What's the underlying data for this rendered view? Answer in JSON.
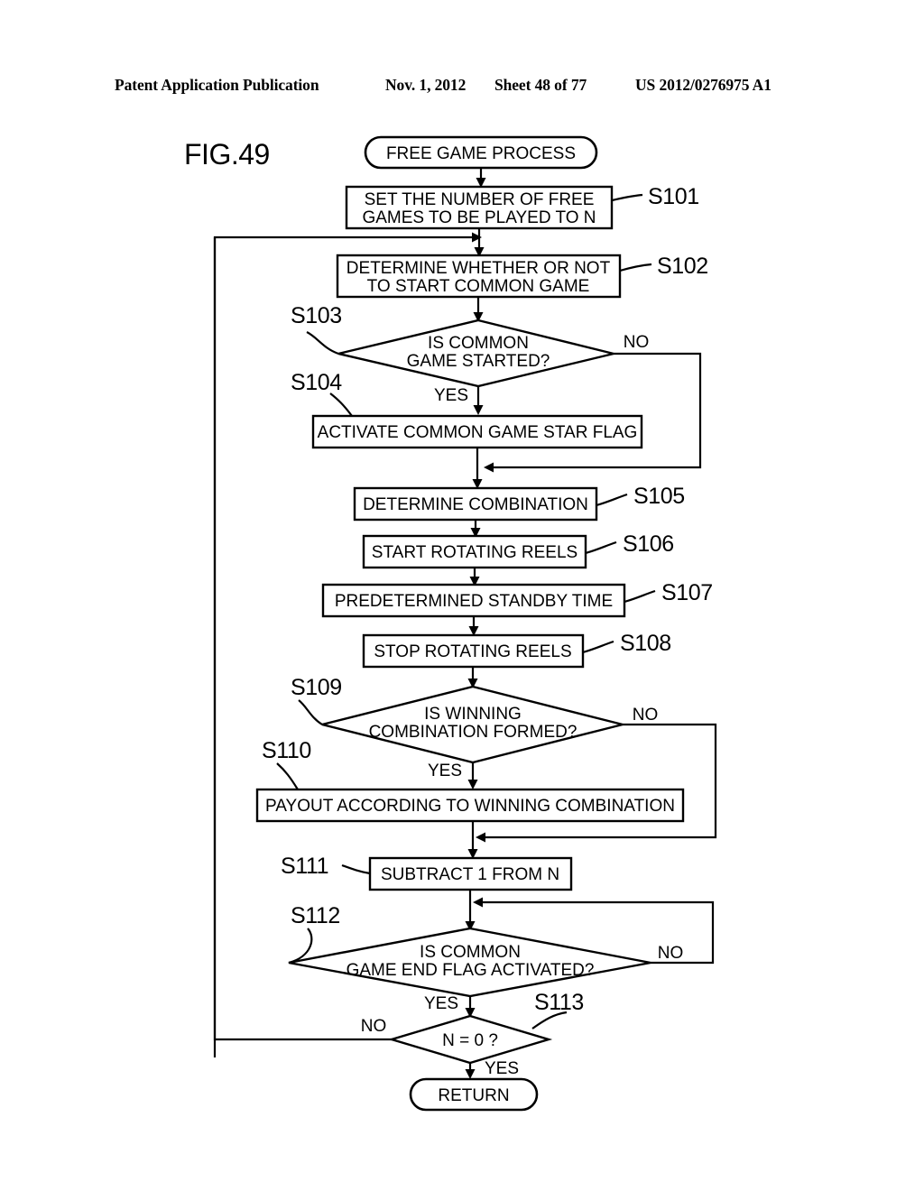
{
  "header": {
    "publication": "Patent Application Publication",
    "date": "Nov. 1, 2012",
    "sheet": "Sheet 48 of 77",
    "number": "US 2012/0276975 A1"
  },
  "figure": {
    "label": "FIG.49"
  },
  "chart_data": {
    "type": "diagram",
    "diagram_kind": "flowchart",
    "title": "FIG.49",
    "nodes": [
      {
        "id": "start",
        "shape": "terminator",
        "text": "FREE GAME PROCESS",
        "step": ""
      },
      {
        "id": "s101",
        "shape": "process",
        "text": "SET THE NUMBER OF FREE GAMES TO BE PLAYED TO N",
        "line1": "SET THE NUMBER OF FREE",
        "line2": "GAMES TO BE PLAYED TO N",
        "step": "S101"
      },
      {
        "id": "s102",
        "shape": "process",
        "text": "DETERMINE WHETHER OR NOT TO START COMMON GAME",
        "line1": "DETERMINE WHETHER OR NOT",
        "line2": "TO START COMMON GAME",
        "step": "S102"
      },
      {
        "id": "s103",
        "shape": "decision",
        "text": "IS COMMON GAME STARTED?",
        "line1": "IS COMMON",
        "line2": "GAME STARTED?",
        "step": "S103"
      },
      {
        "id": "s104",
        "shape": "process",
        "text": "ACTIVATE COMMON GAME STAR FLAG",
        "line1": "ACTIVATE COMMON GAME STAR FLAG",
        "step": "S104"
      },
      {
        "id": "s105",
        "shape": "process",
        "text": "DETERMINE COMBINATION",
        "line1": "DETERMINE COMBINATION",
        "step": "S105"
      },
      {
        "id": "s106",
        "shape": "process",
        "text": "START ROTATING REELS",
        "line1": "START ROTATING REELS",
        "step": "S106"
      },
      {
        "id": "s107",
        "shape": "process",
        "text": "PREDETERMINED STANDBY TIME",
        "line1": "PREDETERMINED STANDBY TIME",
        "step": "S107"
      },
      {
        "id": "s108",
        "shape": "process",
        "text": "STOP ROTATING REELS",
        "line1": "STOP ROTATING REELS",
        "step": "S108"
      },
      {
        "id": "s109",
        "shape": "decision",
        "text": "IS WINNING COMBINATION FORMED?",
        "line1": "IS WINNING",
        "line2": "COMBINATION FORMED?",
        "step": "S109"
      },
      {
        "id": "s110",
        "shape": "process",
        "text": "PAYOUT ACCORDING TO WINNING COMBINATION",
        "line1": "PAYOUT ACCORDING TO WINNING COMBINATION",
        "step": "S110"
      },
      {
        "id": "s111",
        "shape": "process",
        "text": "SUBTRACT 1 FROM N",
        "line1": "SUBTRACT 1 FROM N",
        "step": "S111"
      },
      {
        "id": "s112",
        "shape": "decision",
        "text": "IS COMMON GAME END FLAG ACTIVATED?",
        "line1": "IS COMMON",
        "line2": "GAME END FLAG ACTIVATED?",
        "step": "S112"
      },
      {
        "id": "s113",
        "shape": "decision",
        "text": "N = 0 ?",
        "line1": "N = 0 ?",
        "step": "S113"
      },
      {
        "id": "return",
        "shape": "terminator",
        "text": "RETURN",
        "step": ""
      }
    ],
    "edges": [
      {
        "from": "start",
        "to": "s101",
        "label": ""
      },
      {
        "from": "s101",
        "to": "s102",
        "label": ""
      },
      {
        "from": "s102",
        "to": "s103",
        "label": ""
      },
      {
        "from": "s103",
        "to": "s104",
        "label": "YES"
      },
      {
        "from": "s103",
        "to": "s105",
        "label": "NO"
      },
      {
        "from": "s104",
        "to": "s105",
        "label": ""
      },
      {
        "from": "s105",
        "to": "s106",
        "label": ""
      },
      {
        "from": "s106",
        "to": "s107",
        "label": ""
      },
      {
        "from": "s107",
        "to": "s108",
        "label": ""
      },
      {
        "from": "s108",
        "to": "s109",
        "label": ""
      },
      {
        "from": "s109",
        "to": "s110",
        "label": "YES"
      },
      {
        "from": "s109",
        "to": "s111",
        "label": "NO"
      },
      {
        "from": "s110",
        "to": "s111",
        "label": ""
      },
      {
        "from": "s111",
        "to": "s112",
        "label": ""
      },
      {
        "from": "s112",
        "to": "s113",
        "label": "YES"
      },
      {
        "from": "s112",
        "to": "s111",
        "label": "NO"
      },
      {
        "from": "s113",
        "to": "return",
        "label": "YES"
      },
      {
        "from": "s113",
        "to": "s102",
        "label": "NO"
      }
    ],
    "branch_labels": {
      "s103_no": "NO",
      "s103_yes": "YES",
      "s109_no": "NO",
      "s109_yes": "YES",
      "s112_no": "NO",
      "s112_yes": "YES",
      "s113_no": "NO",
      "s113_yes": "YES"
    },
    "colors": {
      "stroke": "#000000",
      "fill": "#ffffff",
      "text": "#000000"
    }
  }
}
